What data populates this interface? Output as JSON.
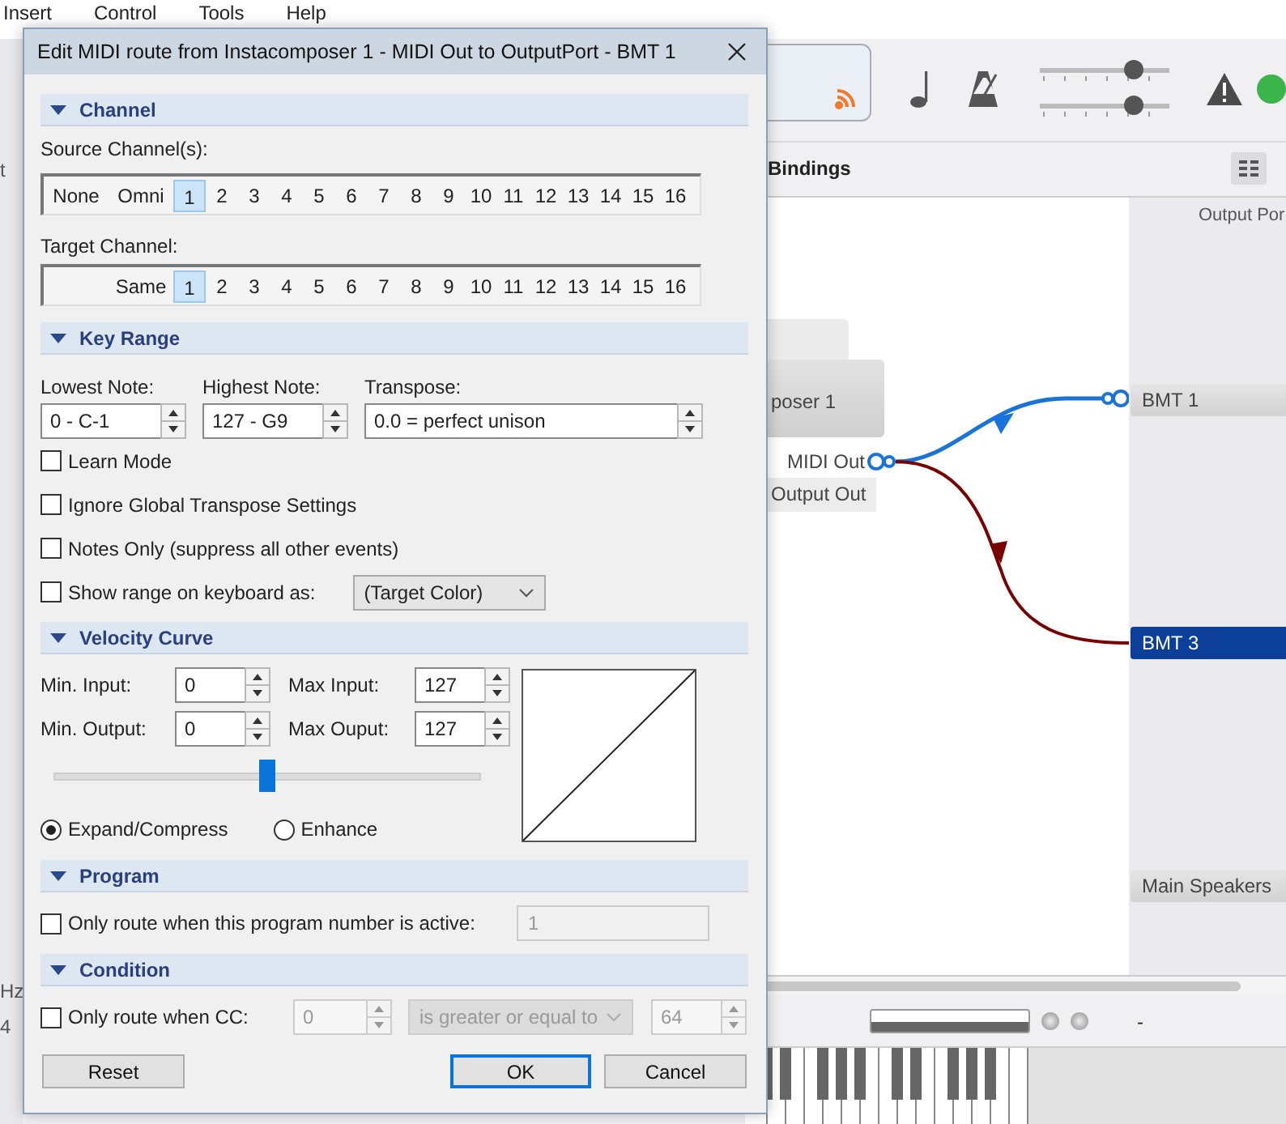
{
  "app": {
    "menu": [
      "Insert",
      "Control",
      "Tools",
      "Help"
    ],
    "left_fragments": [
      {
        "text": "t"
      },
      {
        "text": "Hz"
      },
      {
        "text": "4"
      }
    ],
    "toolbar": {
      "sliders": [
        {
          "level": 0.73
        },
        {
          "level": 0.73
        }
      ]
    },
    "bindings_title": "Bindings",
    "canvas": {
      "node_label": "poser 1",
      "ports": [
        "MIDI Out",
        "Output Out"
      ],
      "routes": [
        {
          "color": "#1a73d9",
          "kind": "rising"
        },
        {
          "color": "#7a0000",
          "kind": "falling"
        }
      ]
    },
    "output_panel": {
      "header": "Output Por",
      "items": [
        {
          "label": "BMT 1",
          "selected": false
        },
        {
          "label": "BMT 3",
          "selected": true
        },
        {
          "label": "Main Speakers",
          "selected": false
        }
      ]
    },
    "status": "-"
  },
  "dialog": {
    "title": "Edit MIDI route from Instacomposer 1 - MIDI Out to OutputPort - BMT 1",
    "channel": {
      "title": "Channel",
      "expanded": true,
      "source_label": "Source Channel(s):",
      "source": [
        {
          "label": "None",
          "selected": false
        },
        {
          "label": "Omni",
          "selected": false
        },
        {
          "label": "1",
          "selected": true
        },
        {
          "label": "2",
          "selected": false
        },
        {
          "label": "3",
          "selected": false
        },
        {
          "label": "4",
          "selected": false
        },
        {
          "label": "5",
          "selected": false
        },
        {
          "label": "6",
          "selected": false
        },
        {
          "label": "7",
          "selected": false
        },
        {
          "label": "8",
          "selected": false
        },
        {
          "label": "9",
          "selected": false
        },
        {
          "label": "10",
          "selected": false
        },
        {
          "label": "11",
          "selected": false
        },
        {
          "label": "12",
          "selected": false
        },
        {
          "label": "13",
          "selected": false
        },
        {
          "label": "14",
          "selected": false
        },
        {
          "label": "15",
          "selected": false
        },
        {
          "label": "16",
          "selected": false
        }
      ],
      "target_label": "Target Channel:",
      "target": [
        {
          "label": "Same",
          "selected": false
        },
        {
          "label": "1",
          "selected": true
        },
        {
          "label": "2",
          "selected": false
        },
        {
          "label": "3",
          "selected": false
        },
        {
          "label": "4",
          "selected": false
        },
        {
          "label": "5",
          "selected": false
        },
        {
          "label": "6",
          "selected": false
        },
        {
          "label": "7",
          "selected": false
        },
        {
          "label": "8",
          "selected": false
        },
        {
          "label": "9",
          "selected": false
        },
        {
          "label": "10",
          "selected": false
        },
        {
          "label": "11",
          "selected": false
        },
        {
          "label": "12",
          "selected": false
        },
        {
          "label": "13",
          "selected": false
        },
        {
          "label": "14",
          "selected": false
        },
        {
          "label": "15",
          "selected": false
        },
        {
          "label": "16",
          "selected": false
        }
      ]
    },
    "key_range": {
      "title": "Key Range",
      "expanded": true,
      "fields": [
        {
          "label": "Lowest Note:",
          "value": "0 - C-1"
        },
        {
          "label": "Highest Note:",
          "value": "127 - G9"
        },
        {
          "label": "Transpose:",
          "value": "0.0 = perfect unison"
        }
      ],
      "options": [
        {
          "label": "Learn Mode",
          "checked": false
        },
        {
          "label": "Ignore Global Transpose Settings",
          "checked": false
        },
        {
          "label": "Notes Only (suppress all other events)",
          "checked": false
        },
        {
          "label": "Show range on keyboard as:",
          "checked": false
        }
      ],
      "range_color": "(Target Color)"
    },
    "velocity": {
      "title": "Velocity Curve",
      "expanded": true,
      "fields": [
        {
          "label": "Min. Input:",
          "value": "0"
        },
        {
          "label": "Max Input:",
          "value": "127"
        },
        {
          "label": "Min. Output:",
          "value": "0"
        },
        {
          "label": "Max Ouput:",
          "value": "127"
        }
      ],
      "slider": {
        "level": 0.5
      },
      "modes": [
        {
          "label": "Expand/Compress",
          "selected": true
        },
        {
          "label": "Enhance",
          "selected": false
        }
      ]
    },
    "program": {
      "title": "Program",
      "expanded": true,
      "label": "Only route when this program number is active:",
      "checked": false,
      "value": "1",
      "disabled": true
    },
    "condition": {
      "title": "Condition",
      "expanded": true,
      "label": "Only route when CC:",
      "checked": false,
      "cc": "0",
      "comparison": "is greater or equal to",
      "value": "64",
      "disabled": true
    },
    "buttons": [
      {
        "label": "Reset",
        "default": false
      },
      {
        "label": "OK",
        "default": true
      },
      {
        "label": "Cancel",
        "default": false
      }
    ]
  }
}
